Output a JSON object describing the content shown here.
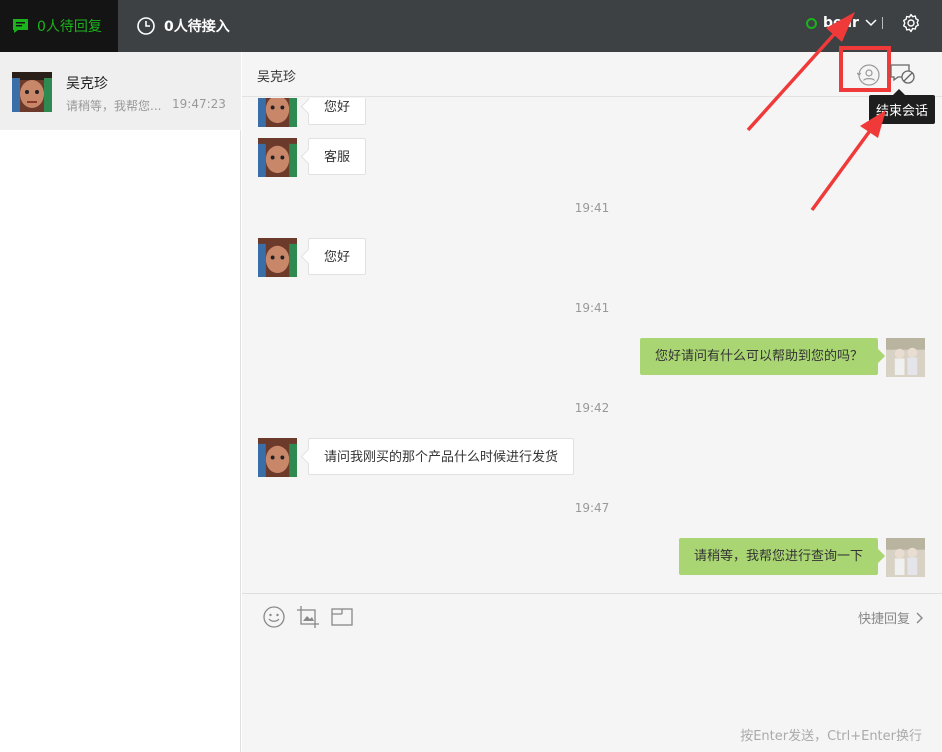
{
  "topbar": {
    "tab_replies": "0人待回复",
    "tab_pending": "0人待接入",
    "username": "bear"
  },
  "sidebar": {
    "conversations": [
      {
        "name": "吴克珍",
        "preview": "请稍等，我帮您...",
        "time": "19:47:23"
      }
    ]
  },
  "chat": {
    "title": "吴克珍",
    "tooltip": "结束会话",
    "messages": [
      {
        "dir": "in",
        "text": "您好"
      },
      {
        "dir": "in",
        "text": "客服"
      },
      {
        "time": "19:41"
      },
      {
        "dir": "in",
        "text": "您好"
      },
      {
        "time": "19:41"
      },
      {
        "dir": "out",
        "text": "您好请问有什么可以帮助到您的吗？"
      },
      {
        "time": "19:42"
      },
      {
        "dir": "in",
        "text": "请问我刚买的那个产品什么时候进行发货"
      },
      {
        "time": "19:47"
      },
      {
        "dir": "out",
        "text": "请稍等，我帮您进行查询一下"
      }
    ]
  },
  "composer": {
    "quick_reply": "快捷回复",
    "hint": "按Enter发送，Ctrl+Enter换行",
    "tools": [
      "emoji-icon",
      "image-crop-icon",
      "screenshot-icon"
    ]
  },
  "colors": {
    "accent_green": "#1bb31b",
    "outgoing_bubble": "#a9d672",
    "topbar": "#3d4144",
    "annotation_red": "#f03a3a"
  }
}
